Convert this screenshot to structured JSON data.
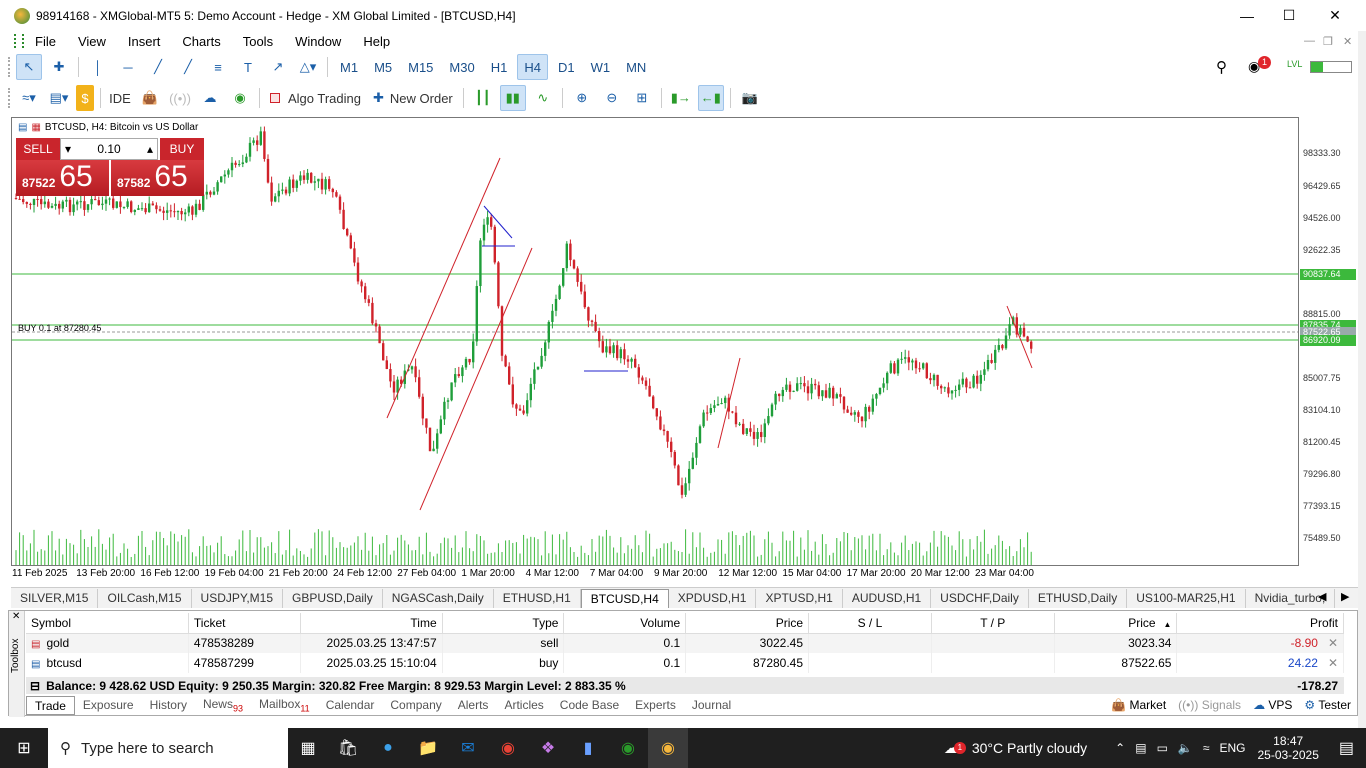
{
  "window": {
    "title": "98914168 - XMGlobal-MT5 5: Demo Account - Hedge - XM Global Limited - [BTCUSD,H4]"
  },
  "menu": [
    "File",
    "View",
    "Insert",
    "Charts",
    "Tools",
    "Window",
    "Help"
  ],
  "timeframes": [
    "M1",
    "M5",
    "M15",
    "M30",
    "H1",
    "H4",
    "D1",
    "W1",
    "MN"
  ],
  "active_timeframe": "H4",
  "toolbar2": {
    "ide": "IDE",
    "algo": "Algo Trading",
    "new_order": "New Order"
  },
  "notification_count": "1",
  "chart": {
    "label": "BTCUSD, H4:  Bitcoin vs US Dollar",
    "position_line": "BUY 0.1 at 87280.45",
    "trade_panel": {
      "sell": "SELL",
      "buy": "BUY",
      "lot": "0.10",
      "sell_small": "87522",
      "sell_big": "65",
      "buy_small": "87582",
      "buy_big": "65"
    },
    "price_ticks": [
      "98333.30",
      "96429.65",
      "94526.00",
      "92622.35",
      "88815.00",
      "85007.75",
      "83104.10",
      "81200.45",
      "79296.80",
      "77393.15",
      "75489.50"
    ],
    "price_tags": [
      {
        "text": "90837.64",
        "color": "#3cb93c"
      },
      {
        "text": "87835.74",
        "color": "#3cb93c"
      },
      {
        "text": "87522.65",
        "color": "#9aa"
      },
      {
        "text": "86920.09",
        "color": "#3cb93c"
      }
    ],
    "time_labels": [
      "11 Feb 2025",
      "13 Feb 20:00",
      "16 Feb 12:00",
      "19 Feb 04:00",
      "21 Feb 20:00",
      "24 Feb 12:00",
      "27 Feb 04:00",
      "1 Mar 20:00",
      "4 Mar 12:00",
      "7 Mar 04:00",
      "9 Mar 20:00",
      "12 Mar 12:00",
      "15 Mar 04:00",
      "17 Mar 20:00",
      "20 Mar 12:00",
      "23 Mar 04:00"
    ],
    "colors": {
      "up": "#1f9e3a",
      "down": "#d0222a",
      "hline": "#3cb93c",
      "trend": "#d0222a",
      "blue": "#2222cc"
    }
  },
  "symbol_tabs": [
    "SILVER,M15",
    "OILCash,M15",
    "USDJPY,M15",
    "GBPUSD,Daily",
    "NGASCash,Daily",
    "ETHUSD,H1",
    "BTCUSD,H4",
    "XPDUSD,H1",
    "XPTUSD,H1",
    "AUDUSD,H1",
    "USDCHF,Daily",
    "ETHUSD,Daily",
    "US100-MAR25,H1",
    "Nvidia_turbo,"
  ],
  "active_symbol_tab": "BTCUSD,H4",
  "trade_table": {
    "headers": [
      "Symbol",
      "Ticket",
      "Time",
      "Type",
      "Volume",
      "Price",
      "S / L",
      "T / P",
      "Price",
      "Profit"
    ],
    "rows": [
      {
        "symbol": "gold",
        "ticket": "478538289",
        "time": "2025.03.25 13:47:57",
        "type": "sell",
        "volume": "0.1",
        "price": "3022.45",
        "sl": "",
        "tp": "",
        "cur": "3023.34",
        "profit": "-8.90",
        "profit_color": "#d0222a"
      },
      {
        "symbol": "btcusd",
        "ticket": "478587299",
        "time": "2025.03.25 15:10:04",
        "type": "buy",
        "volume": "0.1",
        "price": "87280.45",
        "sl": "",
        "tp": "",
        "cur": "87522.65",
        "profit": "24.22",
        "profit_color": "#1a47c8"
      }
    ],
    "balance_text": "Balance: 9 428.62 USD  Equity: 9 250.35  Margin: 320.82  Free Margin: 8 929.53  Margin Level: 2 883.35 %",
    "total": "-178.27"
  },
  "toolbox_label": "Toolbox",
  "bottom_tabs": [
    {
      "label": "Trade",
      "badge": ""
    },
    {
      "label": "Exposure",
      "badge": ""
    },
    {
      "label": "History",
      "badge": ""
    },
    {
      "label": "News",
      "badge": "93"
    },
    {
      "label": "Mailbox",
      "badge": "11"
    },
    {
      "label": "Calendar",
      "badge": ""
    },
    {
      "label": "Company",
      "badge": ""
    },
    {
      "label": "Alerts",
      "badge": ""
    },
    {
      "label": "Articles",
      "badge": ""
    },
    {
      "label": "Code Base",
      "badge": ""
    },
    {
      "label": "Experts",
      "badge": ""
    },
    {
      "label": "Journal",
      "badge": ""
    }
  ],
  "bottom_right": [
    "Market",
    "Signals",
    "VPS",
    "Tester"
  ],
  "taskbar": {
    "search_placeholder": "Type here to search",
    "weather": "30°C  Partly cloudy",
    "lang": "ENG",
    "time": "18:47",
    "date": "25-03-2025",
    "weather_badge": "1"
  }
}
